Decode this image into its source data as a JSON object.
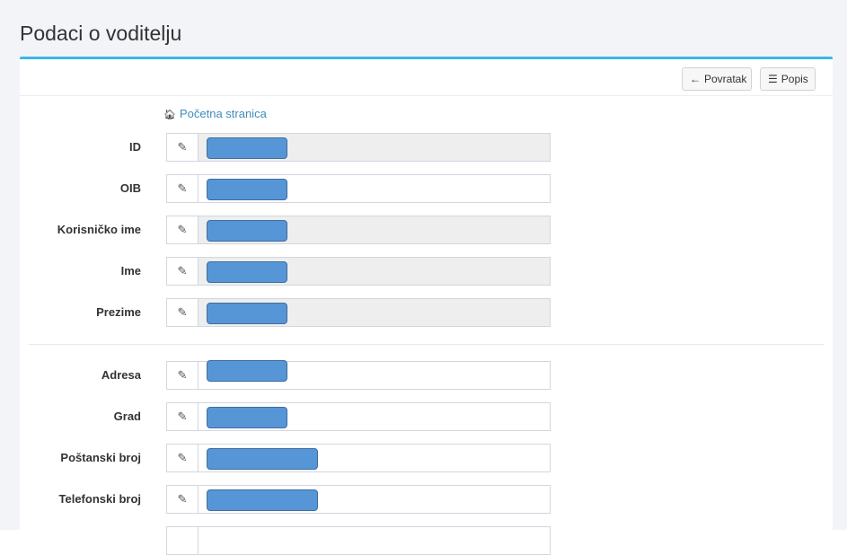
{
  "page": {
    "title": "Podaci o voditelju"
  },
  "toolbar": {
    "back_label": "Povratak",
    "list_label": "Popis"
  },
  "home_link": {
    "label": "Početna stranica"
  },
  "fields": [
    {
      "label": "ID",
      "value": "",
      "readonly": true
    },
    {
      "label": "OIB",
      "value": "",
      "readonly": false
    },
    {
      "label": "Korisničko ime",
      "value": "",
      "readonly": true
    },
    {
      "label": "Ime",
      "value": "",
      "readonly": true
    },
    {
      "label": "Prezime",
      "value": "",
      "readonly": true
    },
    {
      "label": "Adresa",
      "value": "",
      "readonly": false
    },
    {
      "label": "Grad",
      "value": "",
      "readonly": false
    },
    {
      "label": "Poštanski broj",
      "value": "",
      "readonly": false
    },
    {
      "label": "Telefonski broj",
      "value": "",
      "readonly": false
    }
  ],
  "icons": {
    "back": "arrow-left-icon",
    "list": "list-icon",
    "home": "home-icon",
    "edit": "pencil-icon"
  },
  "colors": {
    "accent": "#3ab7e7",
    "link": "#3c8dbc",
    "redaction": "#5796d6"
  }
}
